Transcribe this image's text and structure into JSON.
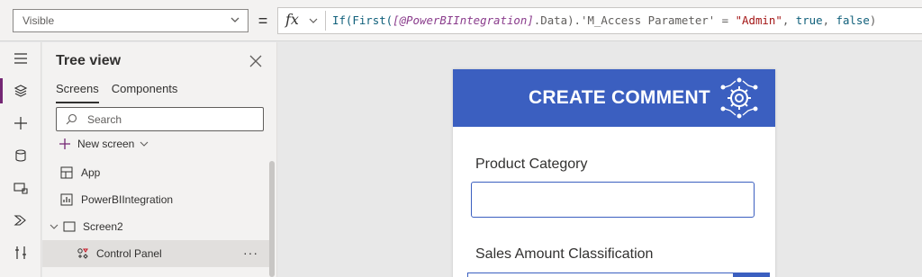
{
  "formula_bar": {
    "property": "Visible",
    "equals": "=",
    "fx_label": "fx",
    "formula_parts": [
      {
        "text": "If(First(",
        "cls": "f-kw"
      },
      {
        "text": "[@PowerBIIntegration]",
        "cls": "f-var"
      },
      {
        "text": ".Data).'M_Access Parameter' = ",
        "cls": "f-plain"
      },
      {
        "text": "\"Admin\"",
        "cls": "f-str"
      },
      {
        "text": ", ",
        "cls": "f-plain"
      },
      {
        "text": "true",
        "cls": "f-bool"
      },
      {
        "text": ", ",
        "cls": "f-plain"
      },
      {
        "text": "false",
        "cls": "f-bool"
      },
      {
        "text": ")",
        "cls": "f-plain"
      }
    ]
  },
  "tree_view": {
    "title": "Tree view",
    "tabs": [
      {
        "label": "Screens",
        "active": true
      },
      {
        "label": "Components",
        "active": false
      }
    ],
    "search_placeholder": "Search",
    "new_screen_label": "New screen",
    "items": [
      {
        "label": "App",
        "icon": "app-icon",
        "indent": 0
      },
      {
        "label": "PowerBIIntegration",
        "icon": "powerbi-control-icon",
        "indent": 0
      },
      {
        "label": "Screen2",
        "icon": "screen-icon",
        "indent": 0,
        "expandable": true
      },
      {
        "label": "Control Panel",
        "icon": "group-icon",
        "indent": 1,
        "selected": true,
        "more": "···"
      }
    ]
  },
  "rail": {
    "icons": [
      "menu-icon",
      "layers-icon",
      "insert-icon",
      "data-icon",
      "media-icon",
      "power-automate-icon",
      "tools-icon"
    ],
    "accent": "#742774"
  },
  "canvas": {
    "header_title": "CREATE COMMENT",
    "header_color": "#3b5fc0",
    "fields": [
      {
        "label": "Product Category"
      },
      {
        "label": "Sales Amount Classification"
      }
    ]
  }
}
